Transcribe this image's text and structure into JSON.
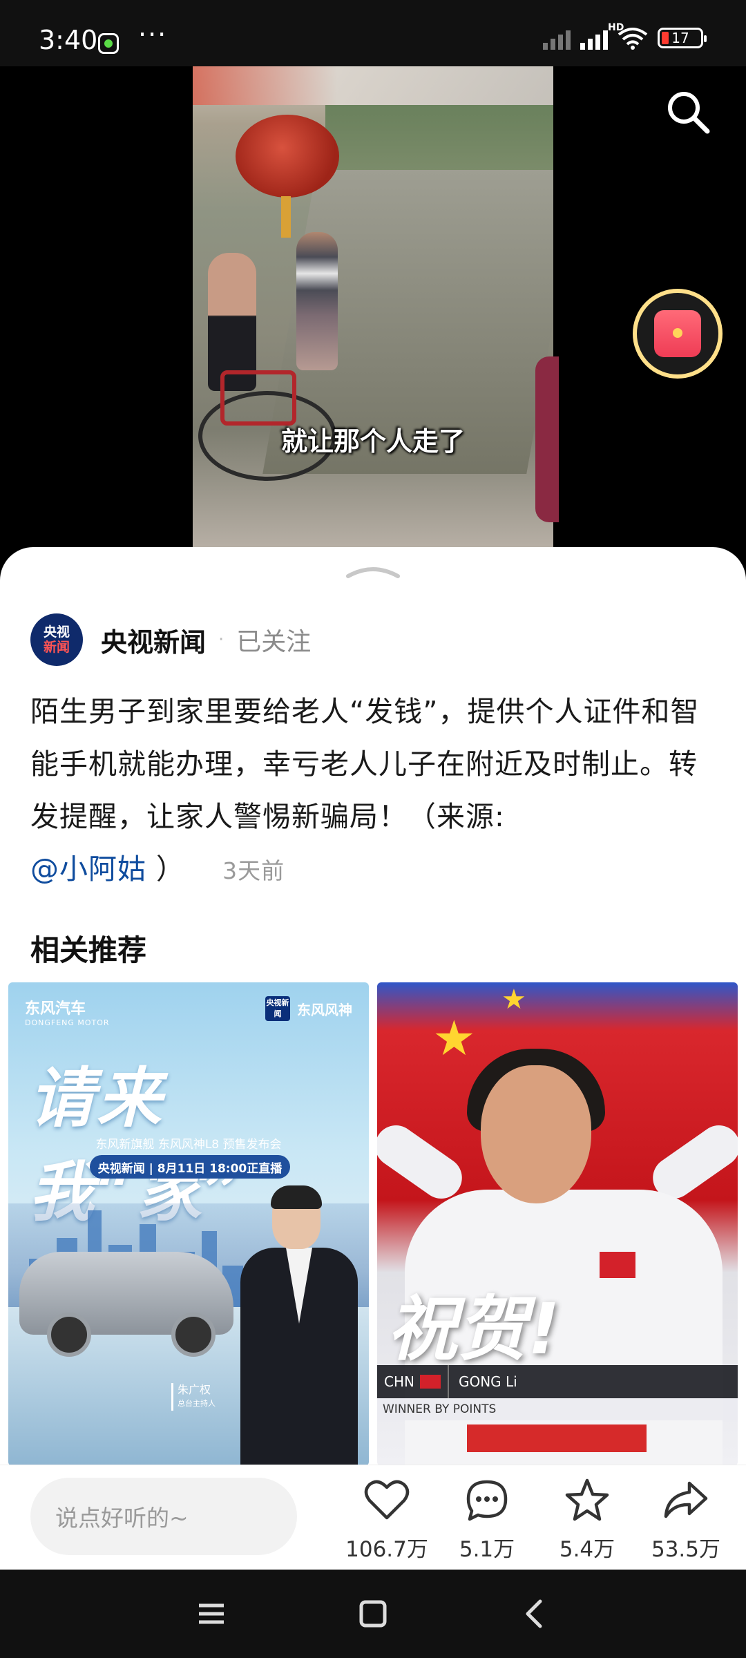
{
  "status_bar": {
    "time": "3:40",
    "dots": "···",
    "network_label": "HD",
    "battery_level": "17"
  },
  "video": {
    "caption": "就让那个人走了"
  },
  "post": {
    "author_name": "央视新闻",
    "avatar_line1": "央视",
    "avatar_line2": "新闻",
    "separator": "·",
    "follow_status": "已关注",
    "description": "陌生男子到家里要给老人“发钱”，提供个人证件和智能手机就能办理，幸亏老人儿子在附近及时制止。转发提醒，让家人警惕新骗局！（来源:",
    "mention": "@小阿姑",
    "description_end": "）",
    "time_ago": "3天前"
  },
  "recommend": {
    "title": "相关推荐",
    "card1": {
      "brand_left": "东风汽车",
      "brand_left_en": "DONGFENG MOTOR",
      "logo_box": "央视新闻",
      "brand_right": "东风风神",
      "headline": "请来我“家”",
      "sub": "东风新旗舰 东风风神L8 预售发布会",
      "pill": "央视新闻 | 8月11日 18:00正直播",
      "host_name": "朱广权",
      "host_title": "总台主持人"
    },
    "card2": {
      "congrats": "祝贺!",
      "country": "CHN",
      "athlete": "GONG Li",
      "result": "WINNER BY POINTS"
    }
  },
  "actions": {
    "comment_placeholder": "说点好听的~",
    "like_count": "106.7万",
    "comment_count": "5.1万",
    "favorite_count": "5.4万",
    "share_count": "53.5万"
  },
  "icons": {
    "search": "search-icon",
    "red_packet": "red-packet-icon",
    "like": "heart-icon",
    "comment": "comment-icon",
    "favorite": "star-icon",
    "share": "share-icon",
    "menu": "menu-icon",
    "home": "home-icon",
    "back": "back-icon"
  },
  "colors": {
    "mention": "#0f4c9e",
    "accent_gold": "#ffe08a",
    "red_packet": "#ef3c55"
  }
}
